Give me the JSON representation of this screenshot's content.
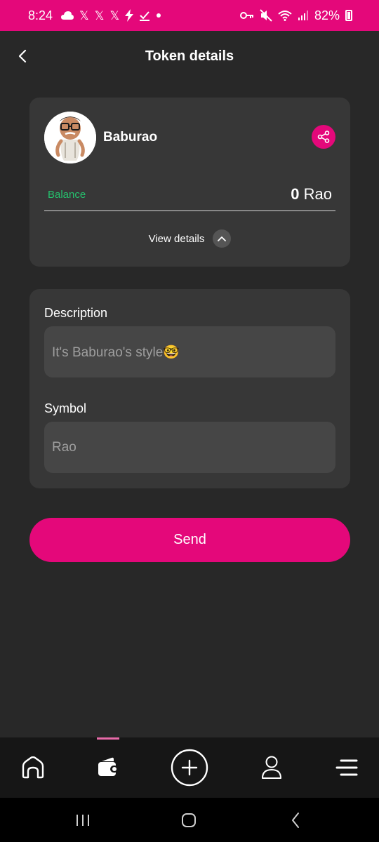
{
  "status_bar": {
    "time": "8:24",
    "left_icons": [
      "cloud-icon",
      "x-icon",
      "x-icon",
      "x-icon",
      "bolt-icon",
      "check-icon",
      "dot-icon"
    ],
    "right_icons": [
      "key-icon",
      "mute-icon",
      "wifi-icon",
      "signal-icon",
      "battery-icon"
    ],
    "battery_percent": "82%",
    "background_color": "#e4087a"
  },
  "header": {
    "title": "Token details"
  },
  "token": {
    "name": "Baburao",
    "balance_label": "Balance",
    "balance_amount": "0",
    "balance_unit": "Rao",
    "view_details_label": "View details"
  },
  "details": {
    "description_label": "Description",
    "description_value": "It's Baburao's style🤓",
    "symbol_label": "Symbol",
    "symbol_value": "Rao"
  },
  "actions": {
    "send_label": "Send"
  },
  "bottom_nav": {
    "items": [
      {
        "icon": "home-icon",
        "active": false
      },
      {
        "icon": "wallet-icon",
        "active": true
      },
      {
        "icon": "plus-circle-icon",
        "active": false
      },
      {
        "icon": "profile-icon",
        "active": false
      },
      {
        "icon": "menu-icon",
        "active": false
      }
    ]
  },
  "colors": {
    "accent": "#e4087a",
    "balance_label": "#25c26e",
    "background": "#282828",
    "card": "#373737"
  }
}
